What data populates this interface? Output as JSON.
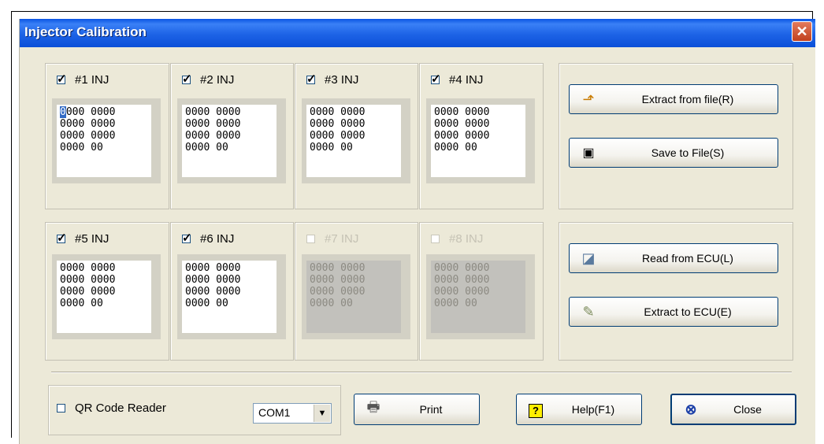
{
  "window": {
    "title": "Injector Calibration",
    "close_glyph": "✕"
  },
  "injectors": [
    {
      "label": "#1 INJ",
      "checked": true,
      "enabled": true,
      "lines": [
        "0000 0000",
        "0000 0000",
        "0000 0000",
        "0000 00"
      ]
    },
    {
      "label": "#2 INJ",
      "checked": true,
      "enabled": true,
      "lines": [
        "0000 0000",
        "0000 0000",
        "0000 0000",
        "0000 00"
      ]
    },
    {
      "label": "#3 INJ",
      "checked": true,
      "enabled": true,
      "lines": [
        "0000 0000",
        "0000 0000",
        "0000 0000",
        "0000 00"
      ]
    },
    {
      "label": "#4 INJ",
      "checked": true,
      "enabled": true,
      "lines": [
        "0000 0000",
        "0000 0000",
        "0000 0000",
        "0000 00"
      ]
    },
    {
      "label": "#5 INJ",
      "checked": true,
      "enabled": true,
      "lines": [
        "0000 0000",
        "0000 0000",
        "0000 0000",
        "0000 00"
      ]
    },
    {
      "label": "#6 INJ",
      "checked": true,
      "enabled": true,
      "lines": [
        "0000 0000",
        "0000 0000",
        "0000 0000",
        "0000 00"
      ]
    },
    {
      "label": "#7 INJ",
      "checked": false,
      "enabled": false,
      "lines": [
        "0000 0000",
        "0000 0000",
        "0000 0000",
        "0000 00"
      ]
    },
    {
      "label": "#8 INJ",
      "checked": false,
      "enabled": false,
      "lines": [
        "0000 0000",
        "0000 0000",
        "0000 0000",
        "0000 00"
      ]
    }
  ],
  "file_buttons": {
    "extract_from_file": "Extract from file(R)",
    "save_to_file": "Save to File(S)"
  },
  "ecu_buttons": {
    "read_from_ecu": "Read from ECU(L)",
    "extract_to_ecu": "Extract to ECU(E)"
  },
  "bottom": {
    "qr_label": "QR Code Reader",
    "qr_checked": false,
    "com_port": "COM1",
    "print": "Print",
    "help": "Help(F1)",
    "close": "Close"
  },
  "icons": {
    "extract_from_file": "folder-arrow-icon",
    "save_to_file": "floppy-disk-icon",
    "read_from_ecu": "ecu-read-icon",
    "extract_to_ecu": "pen-write-icon",
    "print": "printer-icon",
    "help": "help-icon",
    "close": "close-circle-icon"
  },
  "colors": {
    "titlebar": "#0a54e3",
    "window_bg": "#ece9d8",
    "disabled_field": "#c2c1bc"
  }
}
